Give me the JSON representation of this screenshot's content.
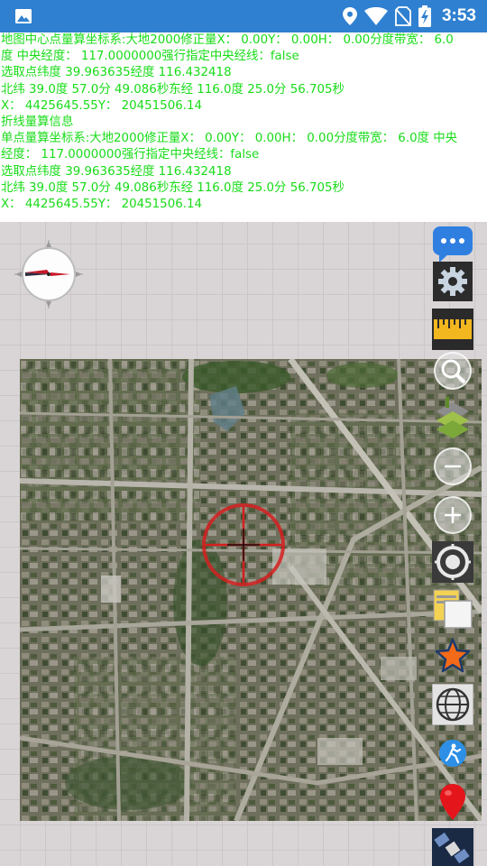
{
  "status_bar": {
    "time": "3:53",
    "icons": [
      "image-icon",
      "location-icon",
      "wifi-icon",
      "no-sim-icon",
      "battery-charging-icon"
    ]
  },
  "info_panel": {
    "lines": [
      "地图中心点量算坐标系:大地2000修正量X：  0.00Y：  0.00H：  0.00分度带宽：  6.0",
      "度 中央经度：  117.0000000强行指定中央经线：false",
      "选取点纬度 39.963635经度 116.432418",
      "北纬 39.0度 57.0分 49.086秒东经 116.0度 25.0分 56.705秒",
      "X：  4425645.55Y：  20451506.14",
      "折线量算信息",
      "单点量算坐标系:大地2000修正量X：  0.00Y：  0.00H：  0.00分度带宽：  6.0度 中央",
      "经度：  117.0000000强行指定中央经线：false",
      "选取点纬度 39.963635经度 116.432418",
      "北纬 39.0度 57.0分 49.086秒东经 116.0度 25.0分 56.705秒",
      "X：  4425645.55Y：  20451506.14",
      "…"
    ],
    "text_color": "#18dc18"
  },
  "toolbar": {
    "items": [
      {
        "name": "message-icon",
        "style": "chat"
      },
      {
        "name": "settings-gear-icon",
        "style": "gear"
      },
      {
        "name": "ruler-icon",
        "style": "ruler"
      },
      {
        "name": "zoom-search-icon",
        "style": "search"
      },
      {
        "name": "layers-map-icon",
        "style": "layers"
      },
      {
        "name": "zoom-out-icon",
        "style": "minus"
      },
      {
        "name": "zoom-in-icon",
        "style": "plus"
      },
      {
        "name": "locate-target-icon",
        "style": "target"
      },
      {
        "name": "folder-cards-icon",
        "style": "folder"
      },
      {
        "name": "favorite-star-icon",
        "style": "star"
      },
      {
        "name": "grid-globe-icon",
        "style": "globe"
      },
      {
        "name": "walk-track-icon",
        "style": "walk"
      },
      {
        "name": "map-pin-icon",
        "style": "pin"
      },
      {
        "name": "satellite-icon",
        "style": "satellite"
      }
    ]
  },
  "colors": {
    "status_bar": "#2f80d0",
    "crosshair": "#d42020",
    "map_grid": "#cbc6c7",
    "map_background": "#d9d5d6"
  }
}
